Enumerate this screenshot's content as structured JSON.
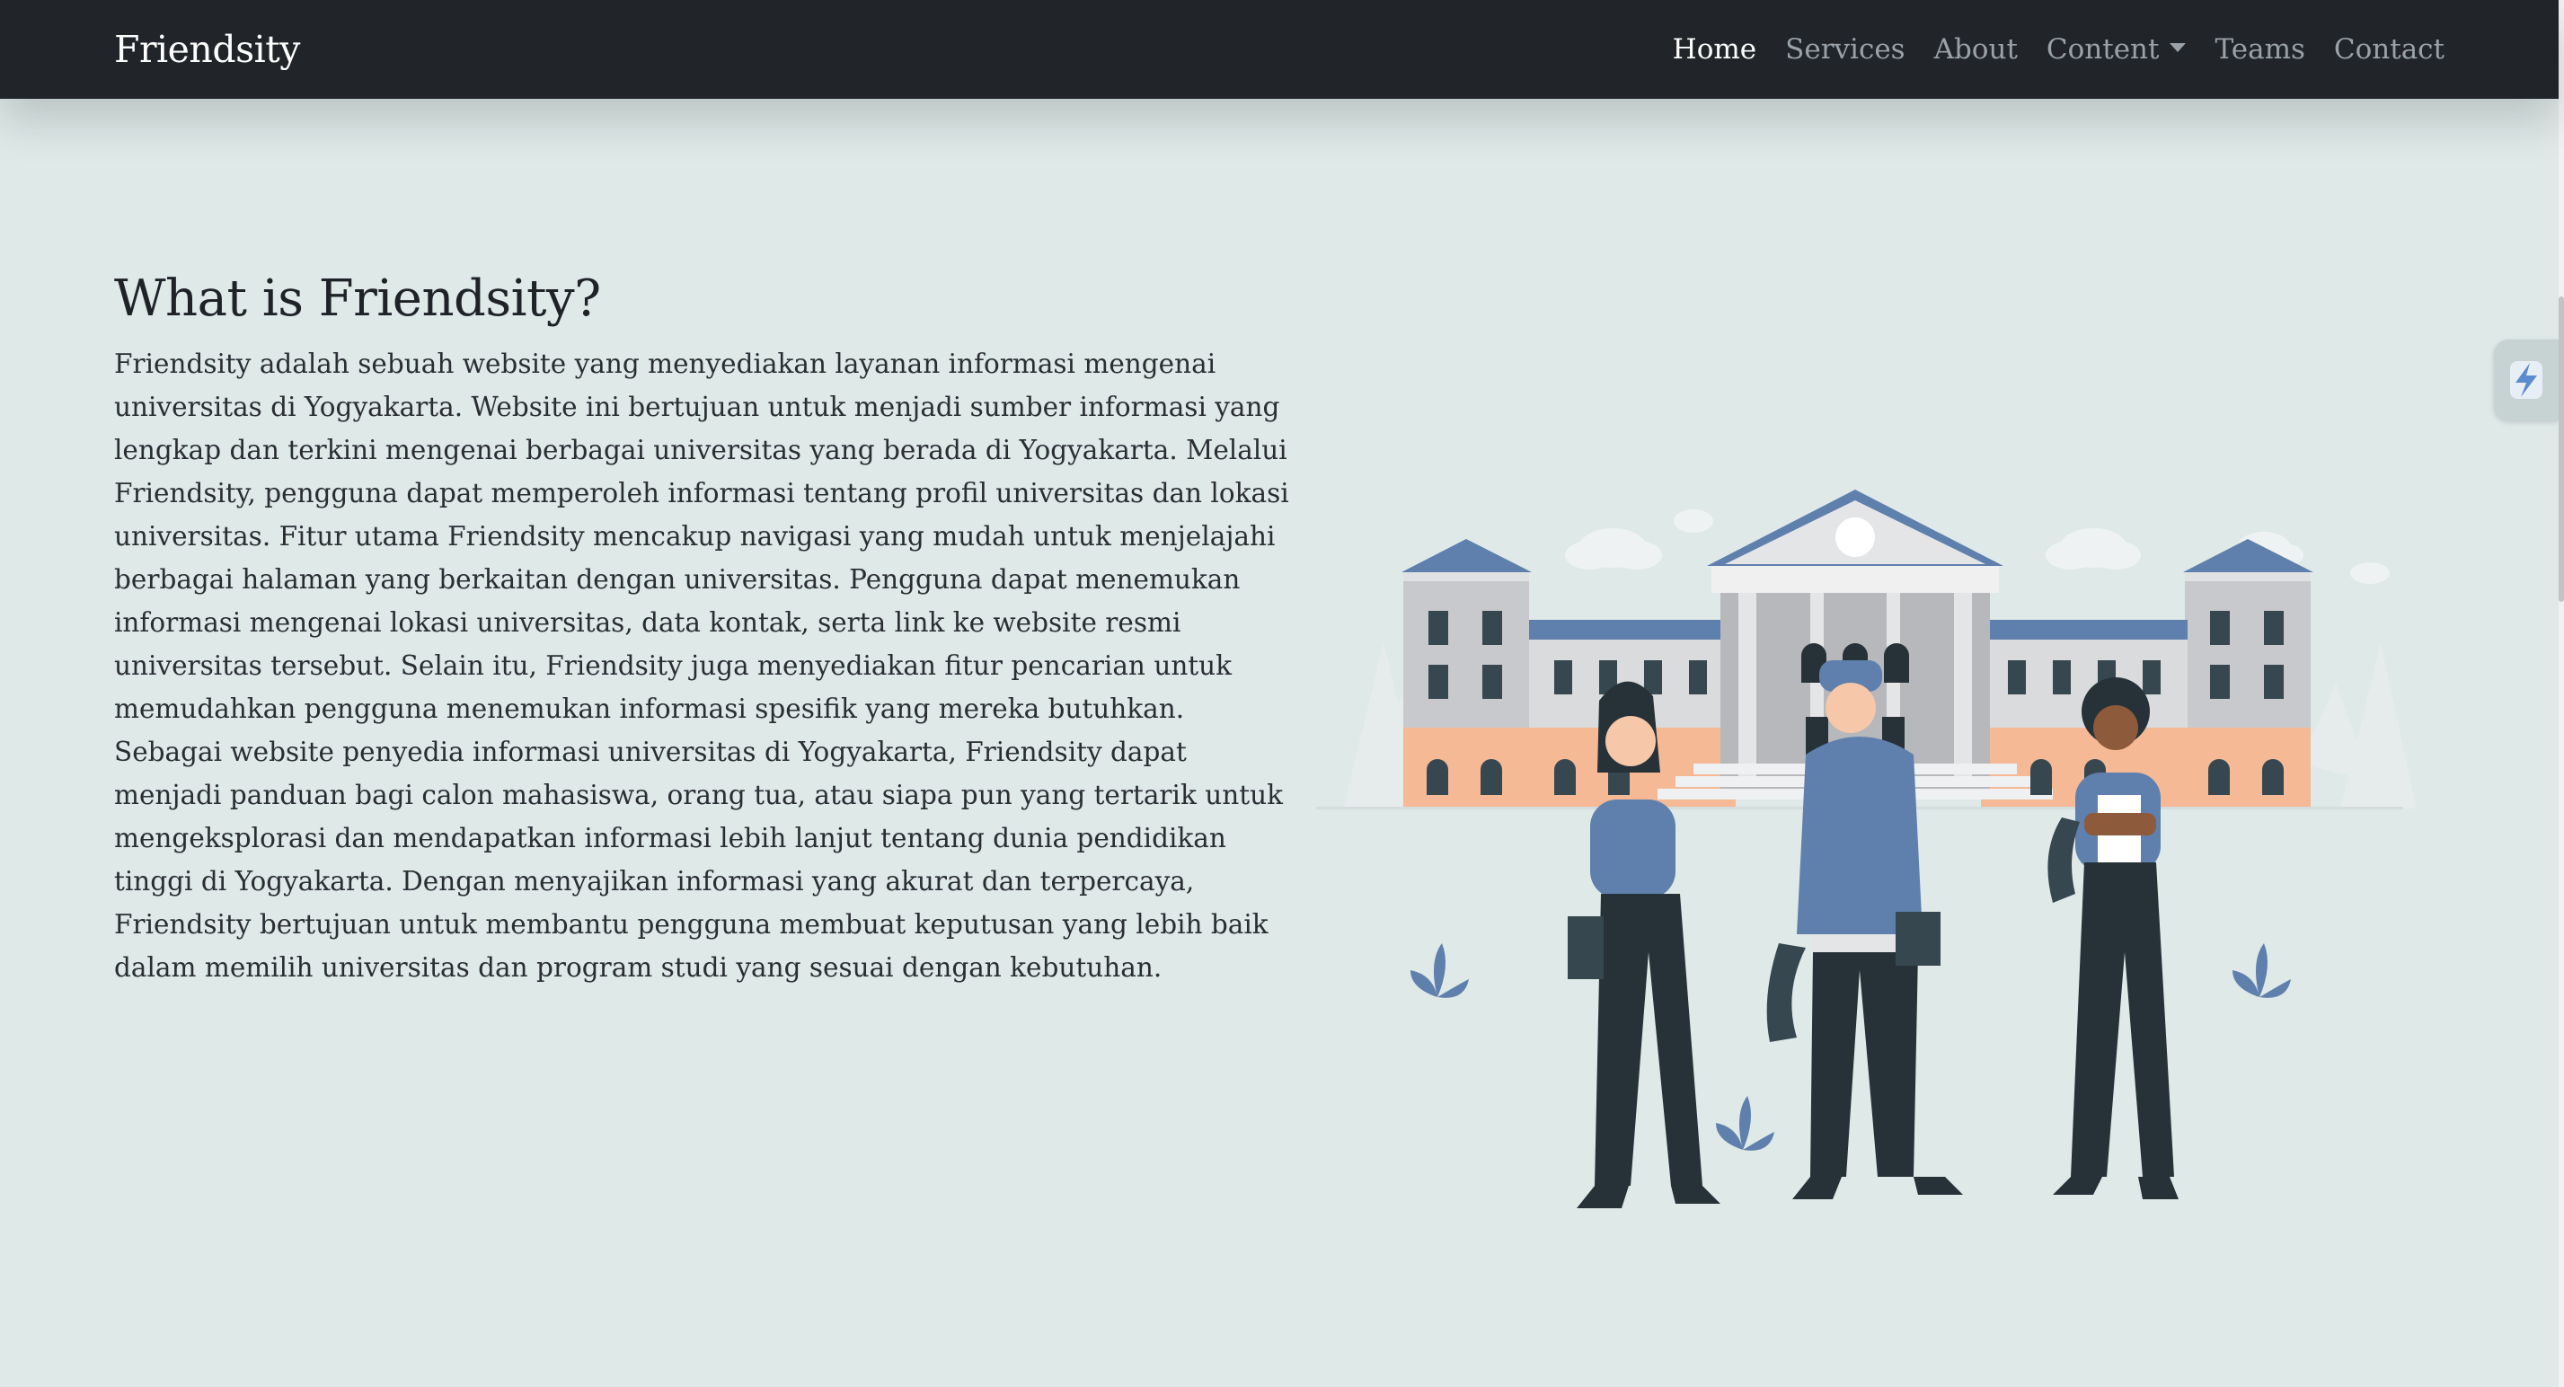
{
  "navbar": {
    "brand": "Friendsity",
    "links": [
      {
        "label": "Home",
        "active": true
      },
      {
        "label": "Services"
      },
      {
        "label": "About"
      },
      {
        "label": "Content",
        "dropdown": true
      },
      {
        "label": "Teams"
      },
      {
        "label": "Contact"
      }
    ]
  },
  "main": {
    "title": "What is Friendsity?",
    "paragraph": "Friendsity adalah sebuah website yang menyediakan layanan informasi mengenai universitas di Yogyakarta. Website ini bertujuan untuk menjadi sumber informasi yang lengkap dan terkini mengenai berbagai universitas yang berada di Yogyakarta. Melalui Friendsity, pengguna dapat memperoleh informasi tentang profil universitas dan lokasi universitas. Fitur utama Friendsity mencakup navigasi yang mudah untuk menjelajahi berbagai halaman yang berkaitan dengan universitas. Pengguna dapat menemukan informasi mengenai lokasi universitas, data kontak, serta link ke website resmi universitas tersebut. Selain itu, Friendsity juga menyediakan fitur pencarian untuk memudahkan pengguna menemukan informasi spesifik yang mereka butuhkan. Sebagai website penyedia informasi universitas di Yogyakarta, Friendsity dapat menjadi panduan bagi calon mahasiswa, orang tua, atau siapa pun yang tertarik untuk mengeksplorasi dan mendapatkan informasi lebih lanjut tentang dunia pendidikan tinggi di Yogyakarta. Dengan menyajikan informasi yang akurat dan terpercaya, Friendsity bertujuan untuk membantu pengguna membuat keputusan yang lebih baik dalam memilih universitas dan program studi yang sesuai dengan kebutuhan."
  },
  "colors": {
    "navbar_bg": "#212529",
    "page_bg": "#dee9e8",
    "accent_blue": "#5f80ad",
    "building_base": "#f5b995",
    "building_wall": "#c8c9cc",
    "figure_dark": "#263238"
  },
  "icons": {
    "dropdown": "caret-down-icon",
    "side_widget": "extension-lightning-icon"
  }
}
